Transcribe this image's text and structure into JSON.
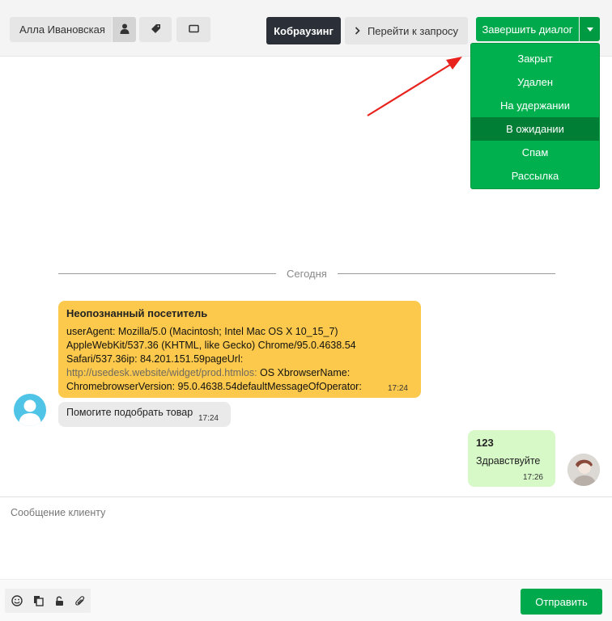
{
  "header": {
    "user_name": "Алла Ивановская",
    "cobrowse_label": "Кобраузинг",
    "goto_request_label": "Перейти к запросу",
    "finish_dialog_label": "Завершить диалог",
    "icons": [
      "user-icon",
      "tag-icon",
      "window-icon",
      "chevron-right-icon",
      "caret-down-icon"
    ]
  },
  "status_menu": {
    "items": [
      "Закрыт",
      "Удален",
      "На удержании",
      "В ожидании",
      "Спам",
      "Рассылка"
    ],
    "highlighted": "В ожидании"
  },
  "chat": {
    "date_divider": "Сегодня",
    "info_message": {
      "title": "Неопознанный посетитель",
      "line1": "userAgent: Mozilla/5.0 (Macintosh; Intel Mac OS X 10_15_7)",
      "line2": "AppleWebKit/537.36 (KHTML, like Gecko) Chrome/95.0.4638.54",
      "line3": "Safari/537.36ip: 84.201.151.59pageUrl:",
      "link": "http://usedesk.website/widget/prod.htmlos:",
      "line4_rest": " OS XbrowserName:",
      "line5": "ChromebrowserVersion: 95.0.4638.54defaultMessageOfOperator:",
      "time": "17:24"
    },
    "visitor_message": {
      "text": "Помогите подобрать товар",
      "time": "17:24"
    },
    "agent_message": {
      "name": "123",
      "text": "Здравствуйте",
      "time": "17:26"
    }
  },
  "composer": {
    "placeholder": "Сообщение клиенту",
    "send_label": "Отправить",
    "tools": [
      "emoji-icon",
      "templates-icon",
      "lock-icon",
      "attachment-icon"
    ]
  },
  "colors": {
    "accent_green": "#00a94b",
    "dropdown_green": "#00b04f",
    "dropdown_active": "#007e36",
    "info_bubble": "#fdc94c",
    "agent_bubble": "#d7f9c8",
    "annotation_arrow": "#e8231e"
  }
}
